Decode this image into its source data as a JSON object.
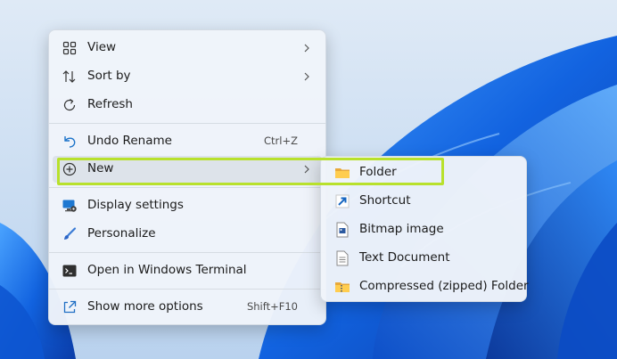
{
  "context_menu": {
    "items": [
      {
        "label": "View",
        "icon": "grid-icon",
        "has_submenu": true
      },
      {
        "label": "Sort by",
        "icon": "sort-arrows-icon",
        "has_submenu": true
      },
      {
        "label": "Refresh",
        "icon": "refresh-icon",
        "has_submenu": false
      },
      {
        "label": "Undo Rename",
        "icon": "undo-icon",
        "shortcut": "Ctrl+Z"
      },
      {
        "label": "New",
        "icon": "plus-circle-icon",
        "has_submenu": true,
        "highlighted": true
      },
      {
        "label": "Display settings",
        "icon": "display-settings-icon"
      },
      {
        "label": "Personalize",
        "icon": "paintbrush-icon"
      },
      {
        "label": "Open in Windows Terminal",
        "icon": "terminal-icon"
      },
      {
        "label": "Show more options",
        "icon": "share-icon",
        "shortcut": "Shift+F10"
      }
    ]
  },
  "new_submenu": {
    "items": [
      {
        "label": "Folder",
        "icon": "folder-icon"
      },
      {
        "label": "Shortcut",
        "icon": "shortcut-arrow-icon"
      },
      {
        "label": "Bitmap image",
        "icon": "bitmap-icon"
      },
      {
        "label": "Text Document",
        "icon": "text-document-icon"
      },
      {
        "label": "Compressed (zipped) Folder",
        "icon": "zip-folder-icon"
      }
    ]
  },
  "colors": {
    "highlight_border": "#b8e12c",
    "menu_background": "#eff4fa",
    "accent": "#0067c0",
    "wallpaper_blue": "#1a6fe0"
  }
}
